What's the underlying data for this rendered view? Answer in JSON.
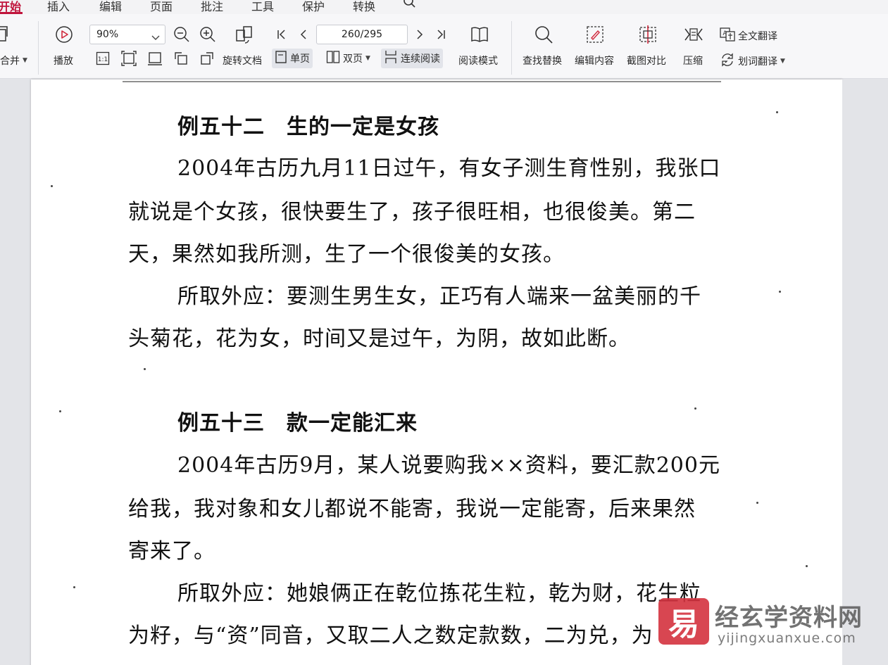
{
  "menu": {
    "tabs": [
      "开始",
      "插入",
      "编辑",
      "页面",
      "批注",
      "工具",
      "保护",
      "转换"
    ]
  },
  "toolbar": {
    "merge_label": "合并",
    "play_label": "播放",
    "zoom_value": "90%",
    "page_value": "260/295",
    "rotate_label": "旋转文档",
    "single_page_label": "单页",
    "double_page_label": "双页",
    "continuous_label": "连续阅读",
    "read_mode_label": "阅读模式",
    "find_replace_label": "查找替换",
    "edit_content_label": "编辑内容",
    "compare_label": "截图对比",
    "compress_label": "压缩",
    "full_translate_label": "全文翻译",
    "word_translate_label": "划词翻译",
    "actual_size_label": "1:1"
  },
  "document": {
    "heading1": "例五十二　生的一定是女孩",
    "p1_lines": [
      "2004年古历九月11日过午，有女子测生育性别，我张口",
      "就说是个女孩，很快要生了，孩子很旺相，也很俊美。第二",
      "天，果然如我所测，生了一个很俊美的女孩。"
    ],
    "p2_lines": [
      "所取外应：要测生男生女，正巧有人端来一盆美丽的千",
      "头菊花，花为女，时间又是过午，为阴，故如此断。"
    ],
    "heading2": "例五十三　款一定能汇来",
    "p3_lines": [
      "2004年古历9月，某人说要购我××资料，要汇款200元",
      "给我，我对象和女儿都说不能寄，我说一定能寄，后来果然",
      "寄来了。"
    ],
    "p4_lines": [
      "所取外应：她娘俩正在乾位拣花生粒，乾为财，花生粒",
      "为籽，与“资”同音，又取二人之数定款数，二为兑，为"
    ]
  },
  "watermark": {
    "badge": "易",
    "title": "经玄学资料网",
    "url": "yijingxuanxue.com"
  }
}
